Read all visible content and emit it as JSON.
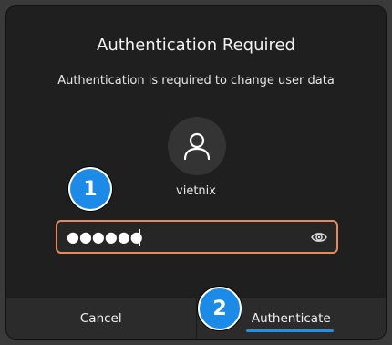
{
  "dialog": {
    "title": "Authentication Required",
    "message": "Authentication is required to change user data",
    "username": "vietnix",
    "password": {
      "masked_value": "●●●●●●",
      "reveal_icon": "eye-icon"
    },
    "avatar_icon": "user-icon",
    "buttons": {
      "cancel_label": "Cancel",
      "authenticate_label": "Authenticate"
    }
  },
  "annotations": {
    "marker1": "1",
    "marker2": "2"
  },
  "colors": {
    "focus_border": "#e8895c",
    "accent": "#1e90f0",
    "marker_fill": "#1c8be8",
    "dialog_bg": "#1f1f1f"
  }
}
